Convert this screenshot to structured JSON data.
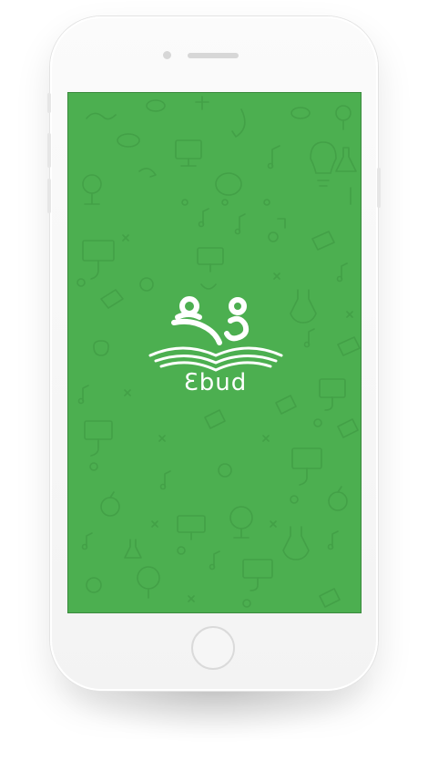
{
  "app": {
    "brand_name": "Ɛbud"
  },
  "splash": {
    "background_color": "#4caf50",
    "doodle_color": "#43a047",
    "logo_color": "#ffffff",
    "icons": [
      "book-reading-logo-icon",
      "doodle-pattern"
    ]
  },
  "device": {
    "frame_color": "#f5f5f5",
    "icons": [
      "camera-icon",
      "speaker-icon",
      "home-button"
    ]
  }
}
